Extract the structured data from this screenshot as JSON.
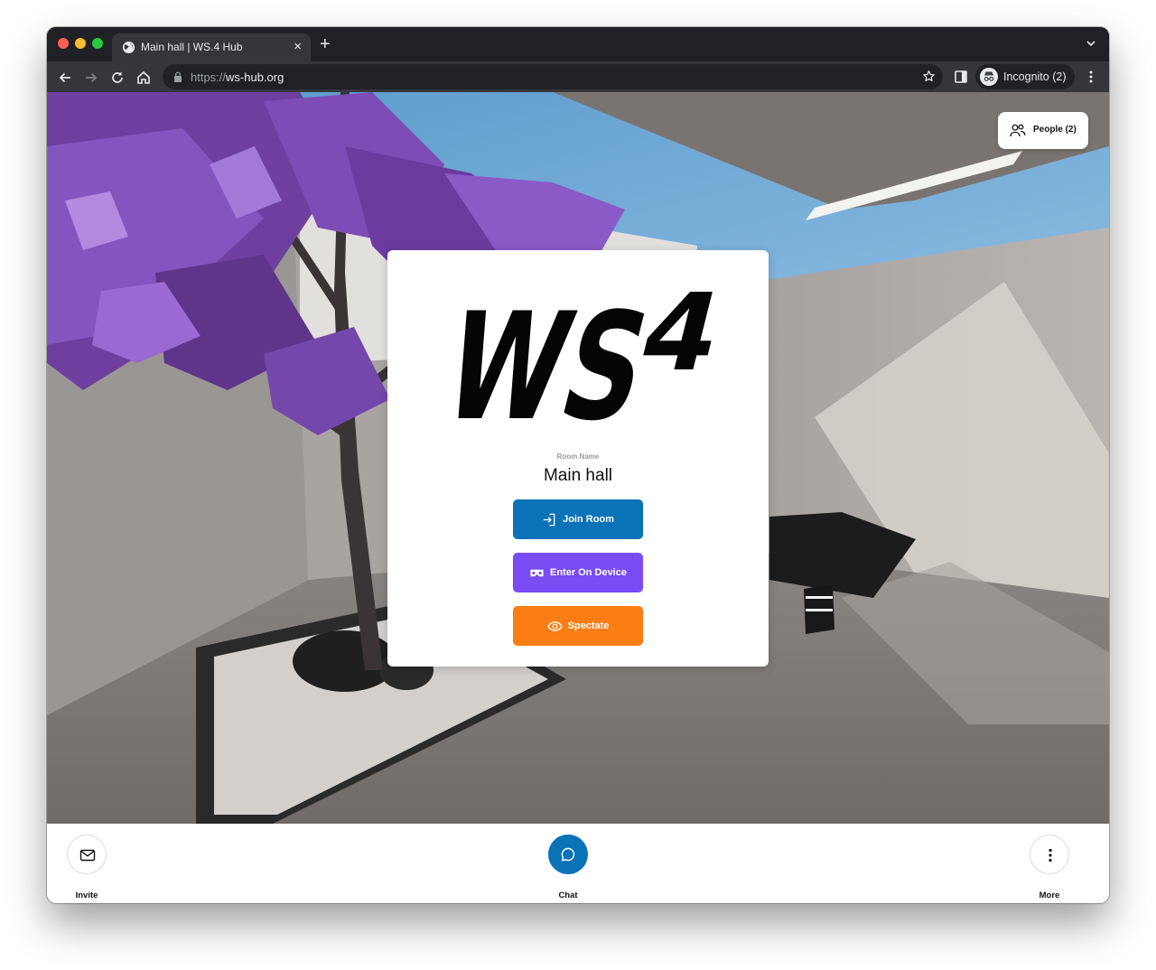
{
  "browser": {
    "tab": {
      "title": "Main hall | WS.4 Hub",
      "favicon": "globe-icon",
      "close": "×"
    },
    "new_tab": "+",
    "url": {
      "scheme": "https://",
      "host": "ws-hub.org"
    },
    "profile": "Incognito (2)"
  },
  "people_button": {
    "label": "People (2)",
    "icon": "people-icon"
  },
  "entry": {
    "logo": "WS4",
    "room_caption": "Room Name",
    "room_name": "Main hall",
    "join_label": "Join Room",
    "device_label": "Enter On Device",
    "spectate_label": "Spectate",
    "colors": {
      "join": "#0a72b6",
      "device": "#7a4cf4",
      "spectate": "#fc7d12"
    }
  },
  "bottom_bar": {
    "invite_label": "Invite",
    "chat_label": "Chat",
    "more_label": "More"
  }
}
